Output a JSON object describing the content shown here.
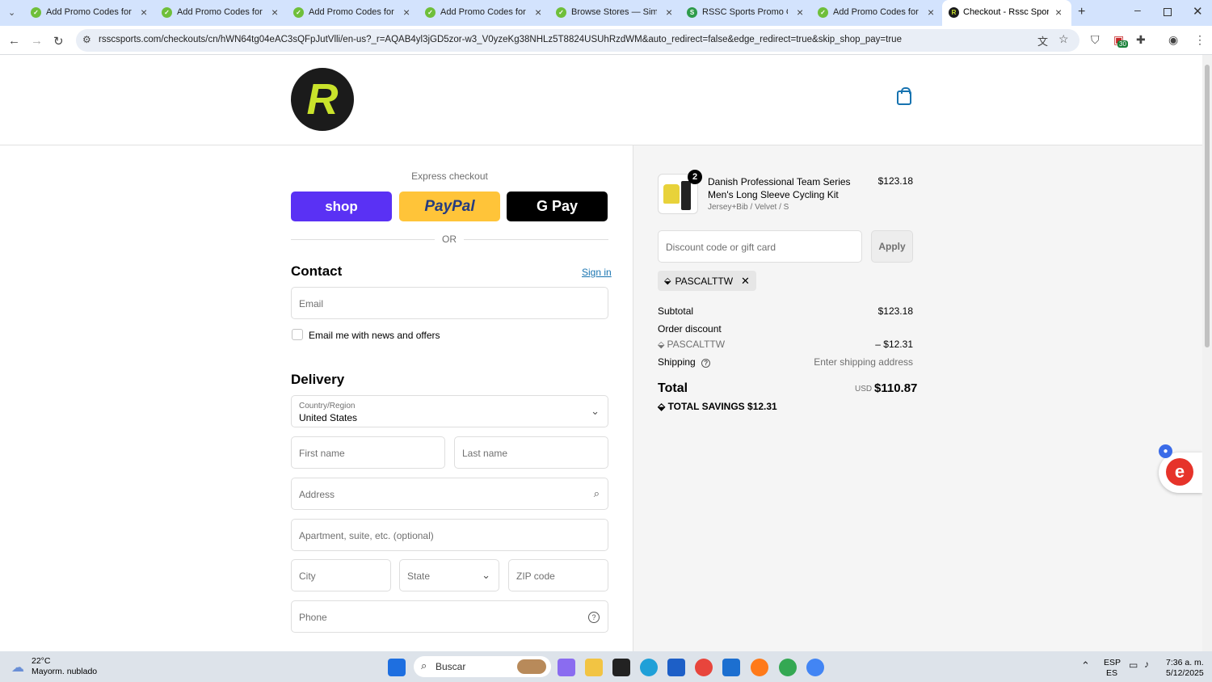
{
  "browser": {
    "tabs": [
      {
        "title": "Add Promo Codes for Fre",
        "active": false
      },
      {
        "title": "Add Promo Codes for De",
        "active": false
      },
      {
        "title": "Add Promo Codes for Ba",
        "active": false
      },
      {
        "title": "Add Promo Codes for No",
        "active": false
      },
      {
        "title": "Browse Stores — SimplyC",
        "active": false
      },
      {
        "title": "RSSC Sports Promo Code",
        "active": false
      },
      {
        "title": "Add Promo Codes for RS",
        "active": false
      },
      {
        "title": "Checkout - Rssc Sports",
        "active": true
      }
    ],
    "url": "rsscsports.com/checkouts/cn/hWN64tg04eAC3sQFpJutVlli/en-us?_r=AQAB4yl3jGD5zor-w3_V0yzeKg38NHLz5T8824USUhRzdWM&auto_redirect=false&edge_redirect=true&skip_shop_pay=true",
    "extension_badge": "30"
  },
  "store": {
    "logo_letter": "R",
    "brand_color": "#c9e22b"
  },
  "checkout": {
    "express_label": "Express checkout",
    "shop_label": "shop",
    "paypal_label": "PayPal",
    "gpay_label": "G Pay",
    "or_label": "OR",
    "contact_heading": "Contact",
    "sign_in": "Sign in",
    "email_placeholder": "Email",
    "newsletter_label": "Email me with news and offers",
    "delivery_heading": "Delivery",
    "country_label": "Country/Region",
    "country_value": "United States",
    "first_name": "First name",
    "last_name": "Last name",
    "address": "Address",
    "apartment": "Apartment, suite, etc. (optional)",
    "city": "City",
    "state": "State",
    "zip": "ZIP code",
    "phone": "Phone"
  },
  "summary": {
    "product_name": "Danish Professional Team Series Men's Long Sleeve Cycling Kit",
    "variant": "Jersey+Bib / Velvet / S",
    "quantity": "2",
    "price": "$123.18",
    "discount_placeholder": "Discount code or gift card",
    "apply_label": "Apply",
    "applied_code": "PASCALTTW",
    "subtotal_label": "Subtotal",
    "subtotal_value": "$123.18",
    "order_discount_label": "Order discount",
    "discount_code": "PASCALTTW",
    "discount_value": "– $12.31",
    "shipping_label": "Shipping",
    "shipping_value": "Enter shipping address",
    "total_label": "Total",
    "total_currency": "USD",
    "total_value": "$110.87",
    "savings_label": "TOTAL SAVINGS",
    "savings_value": "$12.31"
  },
  "taskbar": {
    "weather_temp": "22°C",
    "weather_desc": "Mayorm. nublado",
    "search_label": "Buscar",
    "lang_top": "ESP",
    "lang_bottom": "ES",
    "time": "7:36 a. m.",
    "date": "5/12/2025"
  }
}
